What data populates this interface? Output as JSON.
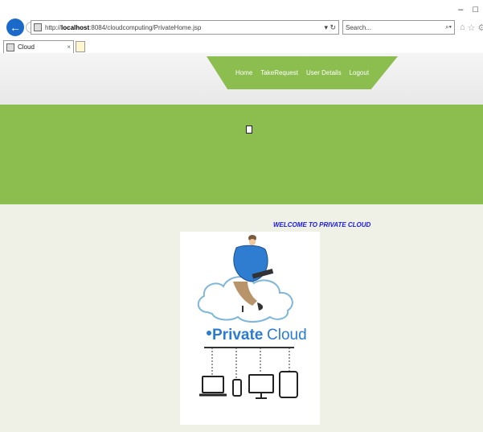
{
  "browser": {
    "url_prefix": "http://",
    "url_host": "localhost",
    "url_rest": ":8084/cloudcomputing/PrivateHome.jsp",
    "search_placeholder": "Search...",
    "tab_title": "Cloud"
  },
  "nav": {
    "items": [
      "Home",
      "TakeRequest",
      "User Details",
      "Logout"
    ]
  },
  "main": {
    "welcome_text": "WELCOME TO PRIVATE CLOUD",
    "logo_text_bold": "Private",
    "logo_text_light": "Cloud"
  },
  "colors": {
    "accent_green": "#8cbd4f",
    "page_bg": "#eff1e6",
    "welcome_blue": "#1a1ae0",
    "logo_blue": "#2b7bd3"
  },
  "icons": [
    "back-arrow-icon",
    "forward-arrow-icon",
    "refresh-icon",
    "search-icon",
    "home-icon",
    "star-icon",
    "gear-icon",
    "page-favicon",
    "broken-image-icon"
  ]
}
